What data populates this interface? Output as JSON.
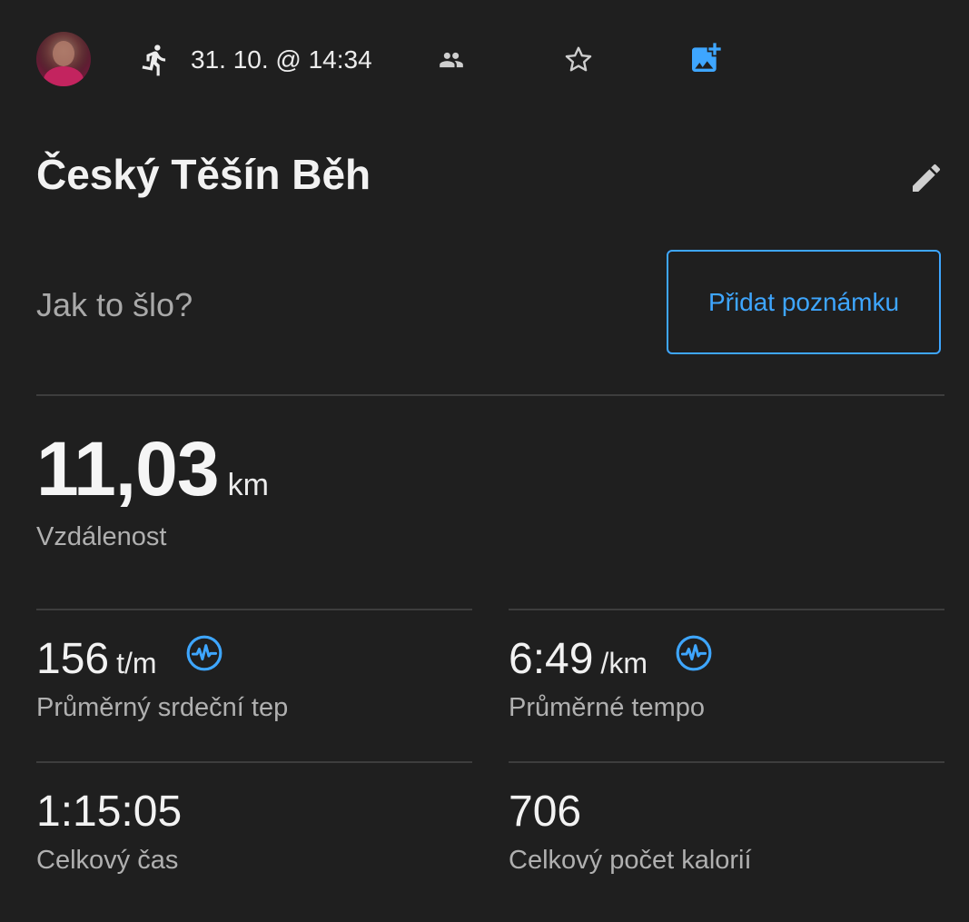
{
  "header": {
    "date_time": "31. 10. @ 14:34",
    "icons": [
      "user-avatar",
      "running-icon",
      "people-icon",
      "star-icon",
      "add-photo-icon"
    ]
  },
  "activity": {
    "title": "Český Těšín Běh",
    "edit_icon": "pencil-icon"
  },
  "note": {
    "prompt": "Jak to šlo?",
    "button_label": "Přidat poznámku"
  },
  "distance": {
    "value": "11,03",
    "unit": "km",
    "label": "Vzdálenost"
  },
  "stats": {
    "heart_rate": {
      "value": "156",
      "unit": "t/m",
      "label": "Průměrný srdeční tep",
      "icon": "heart-rate-icon"
    },
    "pace": {
      "value": "6:49",
      "unit": "/km",
      "label": "Průměrné tempo",
      "icon": "heart-rate-icon"
    },
    "time": {
      "value": "1:15:05",
      "label": "Celkový čas"
    },
    "calories": {
      "value": "706",
      "label": "Celkový počet kalorií"
    }
  },
  "colors": {
    "background": "#1f1f1f",
    "accent": "#3ea6ff",
    "divider": "#3d3d3d",
    "secondary_text": "#b0b0b0"
  }
}
